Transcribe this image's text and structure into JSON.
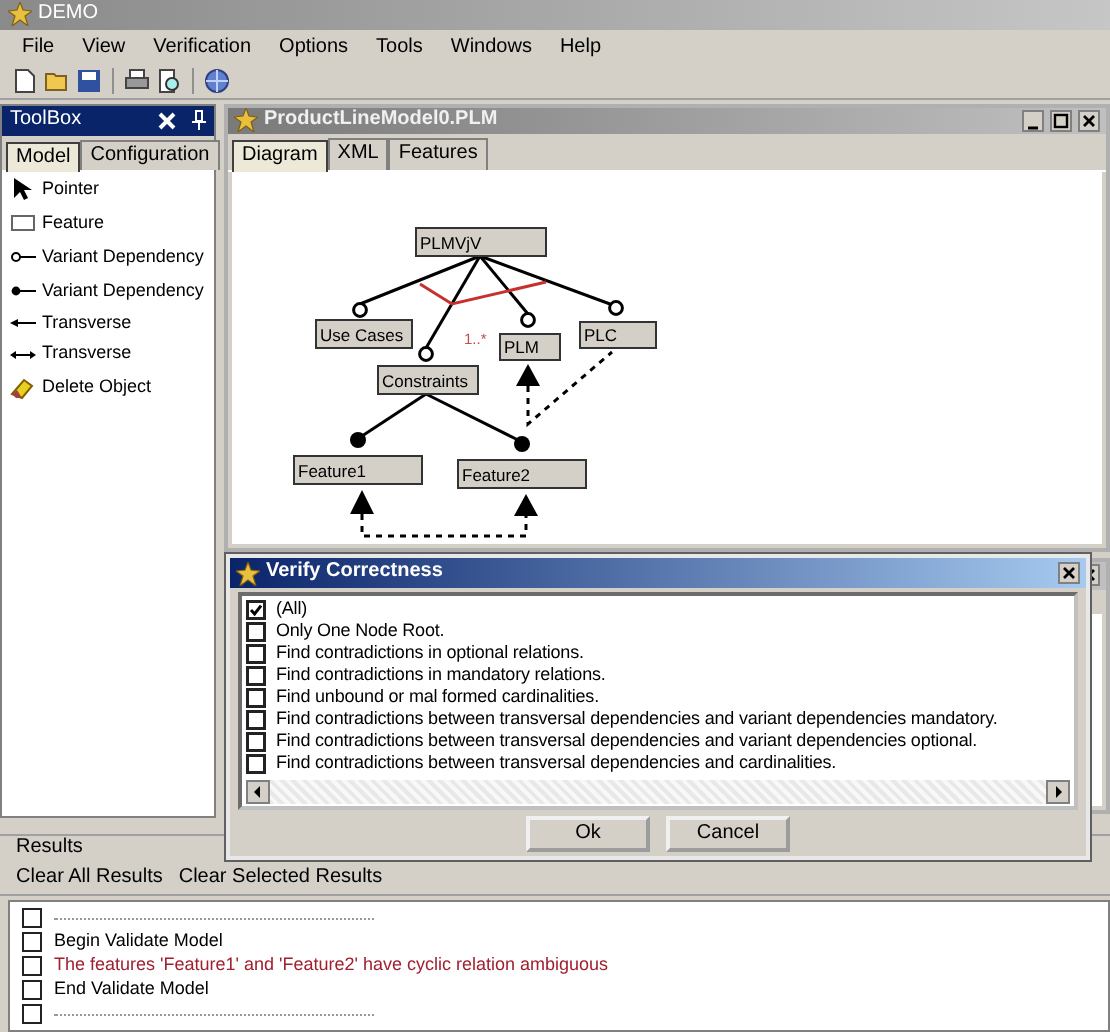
{
  "window": {
    "title": "DEMO"
  },
  "menu": [
    "File",
    "View",
    "Verification",
    "Options",
    "Tools",
    "Windows",
    "Help"
  ],
  "toolbox": {
    "title": "ToolBox",
    "tabs": [
      {
        "label": "Model",
        "selected": true
      },
      {
        "label": "Configuration",
        "selected": false
      }
    ],
    "items": [
      {
        "kind": "pointer",
        "label": "Pointer"
      },
      {
        "kind": "feature",
        "label": "Feature"
      },
      {
        "kind": "optional",
        "label": "Variant Dependency"
      },
      {
        "kind": "mandatory",
        "label": "Variant Dependency"
      },
      {
        "kind": "transverse",
        "label": "Transverse"
      },
      {
        "kind": "bidirectional",
        "label": "Transverse"
      },
      {
        "kind": "delete",
        "label": "Delete Object"
      }
    ]
  },
  "document": {
    "title": "ProductLineModel0.PLM",
    "tabs": [
      {
        "label": "Diagram",
        "selected": true
      },
      {
        "label": "XML",
        "selected": false
      },
      {
        "label": "Features",
        "selected": false
      }
    ],
    "diagram": {
      "nodes": [
        {
          "label": "PLMVjV"
        },
        {
          "label": "Use Cases"
        },
        {
          "label": "Constraints"
        },
        {
          "label": "PLM"
        },
        {
          "label": "PLC"
        },
        {
          "label": "Feature1"
        },
        {
          "label": "Feature2"
        }
      ],
      "cardinality": "1..*"
    }
  },
  "dialog": {
    "title": "Verify Correctness",
    "options": [
      {
        "label": "(All)",
        "checked": true
      },
      {
        "label": "Only One Node Root.",
        "checked": false
      },
      {
        "label": "Find contradictions in optional relations.",
        "checked": false
      },
      {
        "label": "Find contradictions in mandatory relations.",
        "checked": false
      },
      {
        "label": "Find unbound or mal formed cardinalities.",
        "checked": false
      },
      {
        "label": "Find contradictions between transversal dependencies and variant dependencies mandatory.",
        "checked": false
      },
      {
        "label": "Find contradictions between transversal dependencies and variant dependencies optional.",
        "checked": false
      },
      {
        "label": "Find contradictions between transversal dependencies and cardinalities.",
        "checked": false
      }
    ],
    "buttons": [
      "Ok",
      "Cancel"
    ]
  },
  "results": {
    "title": "Results",
    "actions": [
      "Clear All Results",
      "Clear Selected Results"
    ],
    "rows": [
      {
        "kind": "separator",
        "checked": false
      },
      {
        "kind": "info",
        "text": "Begin Validate Model",
        "checked": false
      },
      {
        "kind": "error",
        "text": "The features 'Feature1' and 'Feature2' have cyclic relation ambiguous",
        "checked": false
      },
      {
        "kind": "info",
        "text": "End Validate Model",
        "checked": false
      },
      {
        "kind": "separator",
        "checked": false
      }
    ]
  }
}
